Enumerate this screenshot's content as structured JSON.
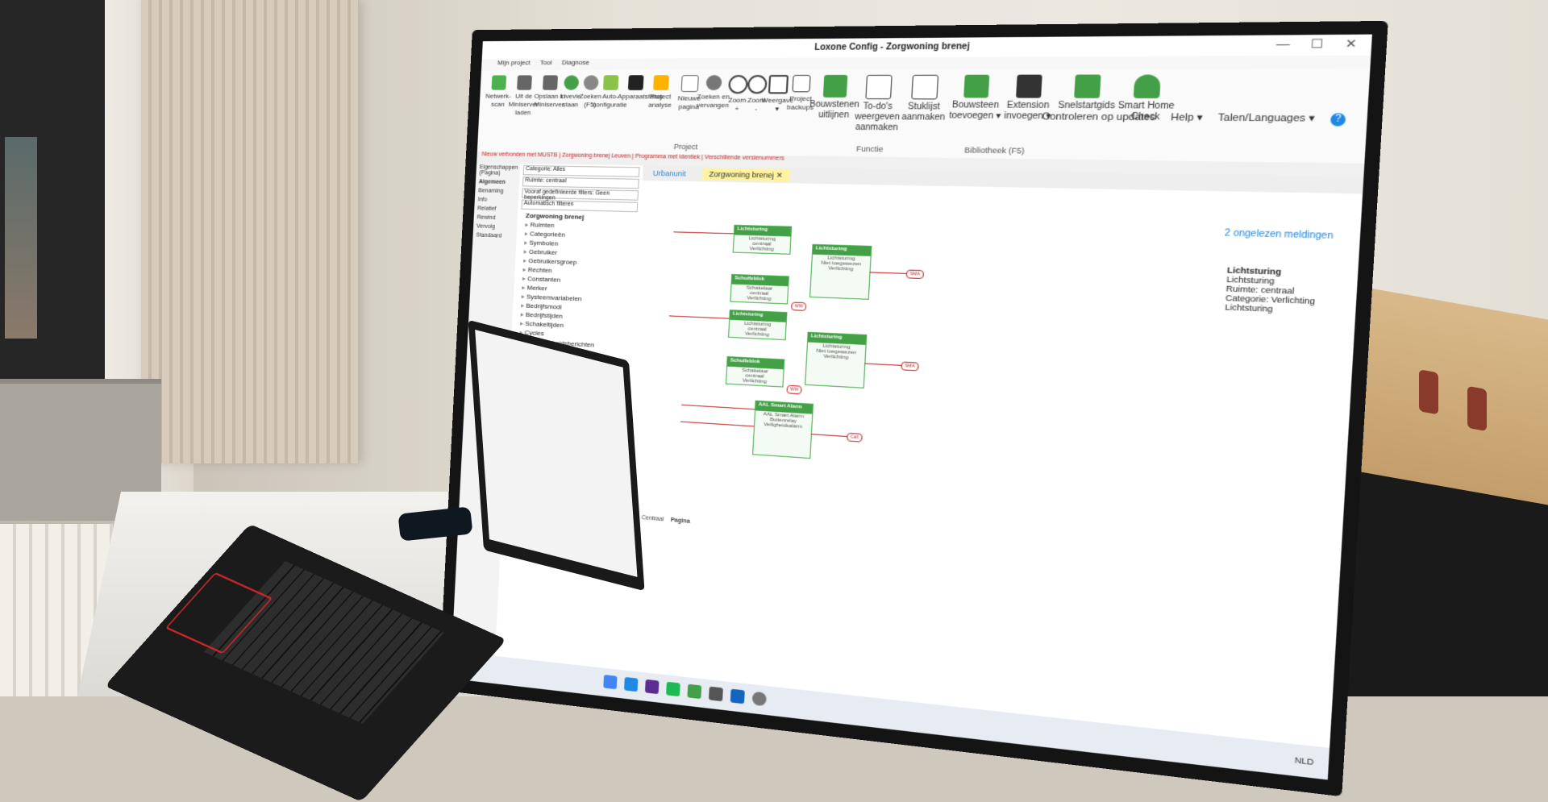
{
  "app": {
    "title": "Loxone Config - Zorgwoning brenej",
    "menu": [
      "Mijn project",
      "Tool",
      "Diagnose"
    ],
    "window_controls": {
      "minimize": "—",
      "maximize": "☐",
      "close": "✕"
    }
  },
  "ribbon": {
    "buttons": [
      {
        "label": "Netwerk-\nscan"
      },
      {
        "label": "Uit de\nMiniserver\nladen"
      },
      {
        "label": "Opslaan in\nMiniserver"
      },
      {
        "label": "Livevie\nstaan"
      },
      {
        "label": "Zoeken\n(F5)"
      },
      {
        "label": "Auto-\nconfiguratie"
      },
      {
        "label": "Apparaatstatus"
      },
      {
        "label": "Project\nanalyse"
      },
      {
        "label": "Nieuwe\npagina"
      },
      {
        "label": "Zoeken en\nvervangen"
      },
      {
        "label": "Zoom\n+"
      },
      {
        "label": "Zoom\n-"
      },
      {
        "label": "Weergave\n▾"
      },
      {
        "label": "Project\nbackups"
      },
      {
        "label": "Bouwstenen\nuitlijnen"
      },
      {
        "label": "To-do's\nweergeven\naanmaken"
      },
      {
        "label": "Stuklijst\naanmaken"
      },
      {
        "label": "Bouwsteen\ntoevoegen ▾"
      },
      {
        "label": "Extension\ninvoegen ▾"
      },
      {
        "label": "Snelstartgids"
      },
      {
        "label": "Smart Home\nCheck"
      }
    ],
    "groups": {
      "project": "Project",
      "functie": "Functie",
      "bibliotheek": "Bibliotheek (F5)"
    },
    "colors": {
      "accent": "#43a047",
      "brand": "#c62828",
      "link": "#1e88e5"
    }
  },
  "topright": {
    "updates": "Controleren op updates",
    "help": "Help ▾",
    "languages": "Talen/Languages ▾",
    "help_icon": "?"
  },
  "tabsbar": [
    "Nieuw verbonden met MUSTB",
    "Zorgwoning brenej Leuven",
    "Programma met identiek",
    "Verschillende versienummers"
  ],
  "leftpanel": [
    "Eigenschappen (Pagina)",
    "Algemeen",
    "Benaming",
    "Info",
    "Relatief",
    "Rewind",
    "Vervolg",
    "Standaard"
  ],
  "nav": {
    "categorie_label": "Categorie",
    "categorie_value": "Alles",
    "ruimte_label": "Ruimte",
    "ruimte_value": "centraal",
    "filter_label": "Vooraf gedefinieerde filters",
    "filter_value": "Geen beperkingen",
    "auto_filter": "Automatisch filteren",
    "tree_root": "Zorgwoning brenej",
    "tree": [
      "Ruimten",
      "Categorieën",
      "Symbolen",
      "Gebruiker",
      "Gebruikersgroep",
      "Rechten",
      "Constanten",
      "Merker",
      "Systeemvariabelen",
      "Bedrijfsmodi",
      "Bedrijfstijden",
      "Schakeltijden",
      "Cycles",
      "Aanwezigheidsberichten"
    ]
  },
  "doctabs": {
    "tab1": "Urbanunit",
    "tab2": "Zorgwoning brenej",
    "close": "✕"
  },
  "canvas": {
    "warning": "2 ongelezen meldingen",
    "blocks": [
      {
        "title": "Lichtsturing",
        "sub": "Lichtsturing\ncentraal\nVerlichting"
      },
      {
        "title": "Lichtsturing",
        "sub": "Lichtsturing\nNiet toegewezen\nVerlichting"
      },
      {
        "title": "Schuifeblok",
        "sub": "Schakelaar\ncentraal\nVerlichting"
      },
      {
        "title": "Lichtsturing",
        "sub": "Lichtsturing\ncentraal\nVerlichting"
      },
      {
        "title": "Lichtsturing",
        "sub": "Lichtsturing\nNiet toegewezen\nVerlichting"
      },
      {
        "title": "Schuifeblok",
        "sub": "Schakelaar\ncentraal\nVerlichting"
      },
      {
        "title": "AAL Smart Alarm",
        "sub": "AAL Smart Alarm\nBuitenrelay\nVeiligheidsalarm"
      }
    ],
    "tags": [
      "SMA",
      "SMA",
      "WW",
      "WW",
      "Cali"
    ],
    "properties": {
      "title": "Lichtsturing",
      "lines": [
        "Lichtsturing",
        "Ruimte: centraal",
        "Categorie: Verlichting",
        "Lichtsturing"
      ]
    },
    "page_tabs": [
      "Centraal",
      "Pagina"
    ]
  },
  "taskbar": {
    "lang": "NLD"
  }
}
